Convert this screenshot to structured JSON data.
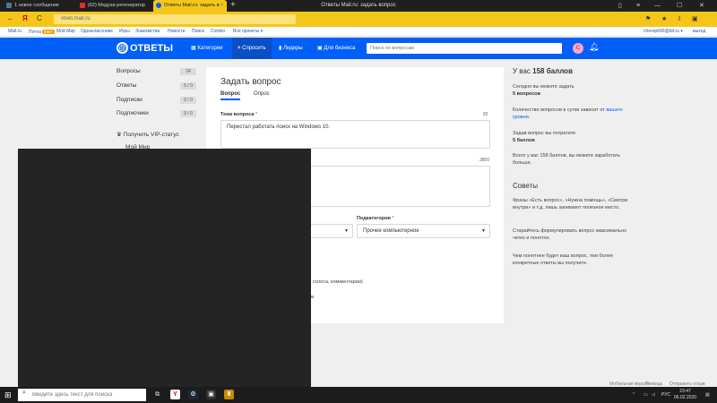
{
  "browser": {
    "tabs": [
      {
        "label": "1 новое сообщение"
      },
      {
        "label": "(62) Медуза-регенератор"
      },
      {
        "label": "Ответы Mail.ru: задать в"
      }
    ],
    "window_title": "Ответы Mail.ru: задать вопрос",
    "url": "otvet.mail.ru",
    "nav": {
      "back": "←",
      "home": "Я",
      "reload": "C"
    }
  },
  "portal": {
    "links": [
      "Mail.ru",
      "Почта",
      "Мой Мир",
      "Одноклассники",
      "Игры",
      "Знакомства",
      "Новости",
      "Поиск",
      "Combo",
      "Все проекты ▾"
    ],
    "mail_badge": "999+",
    "user": "cherep666@bit.ru ▾",
    "logout": "выход"
  },
  "header": {
    "logo": "ОТВЕТЫ",
    "nav": [
      {
        "label": "Категории",
        "icon": "grid-icon"
      },
      {
        "label": "Спросить",
        "icon": "plus-icon"
      },
      {
        "label": "Лидеры",
        "icon": "chart-icon"
      },
      {
        "label": "Для бизнеса",
        "icon": "briefcase-icon"
      }
    ],
    "search_placeholder": "Поиск по вопросам",
    "avatar_letter": "С"
  },
  "sidebar": {
    "items": [
      {
        "label": "Вопросы",
        "count": "24"
      },
      {
        "label": "Ответы",
        "count": "5 / 0"
      },
      {
        "label": "Подписки",
        "count": "0 / 0"
      },
      {
        "label": "Подписчики",
        "count": "0 / 0"
      }
    ],
    "vip": "Получить VIP-статус",
    "my_world": "Мой Мир"
  },
  "form": {
    "title": "Задать вопрос",
    "tabs": [
      "Вопрос",
      "Опрос"
    ],
    "topic_label": "Тема вопроса",
    "topic_count": "82",
    "topic_value": "Перестал работать поиск на Windows 10.",
    "text_count": "3800",
    "subcategory_label": "Подкатегория",
    "subcategory_value": "Прочее компьютерное",
    "fragment_1": "ы, голоса, комментарии)",
    "fragment_2": "етам"
  },
  "right": {
    "points_prefix": "У вас",
    "points": "158 баллов",
    "p1": "Сегодня вы можете задать",
    "p1b": "5 вопросов",
    "p2": "Количество вопросов в сутки зависит от",
    "p2link": "вашего уровня",
    "p3": "Задав вопрос вы потратите",
    "p3b": "5 баллов",
    "p4": "Всего у вас 158 баллов, вы можете заработать больше.",
    "tips_title": "Советы",
    "t1": "Фразы «Есть вопрос», «Нужна помощь», «Смотри внутри» и т.д. лишь занимают полезное место.",
    "t2": "Старайтесь формулировать вопрос максимально четко и понятно.",
    "t3": "Чем понятнее будет ваш вопрос, тем более конкретные ответы вы получите."
  },
  "footer": {
    "links": [
      "Мобильная версия",
      "Помощь",
      "Отправить отзыв"
    ]
  },
  "taskbar": {
    "search_placeholder": "Введите здесь текст для поиска",
    "lang": "РУС",
    "time": "23:47",
    "date": "06.02.2020"
  },
  "colors": {
    "brand_blue": "#005ff9",
    "yandex_yellow": "#f5c61a"
  }
}
